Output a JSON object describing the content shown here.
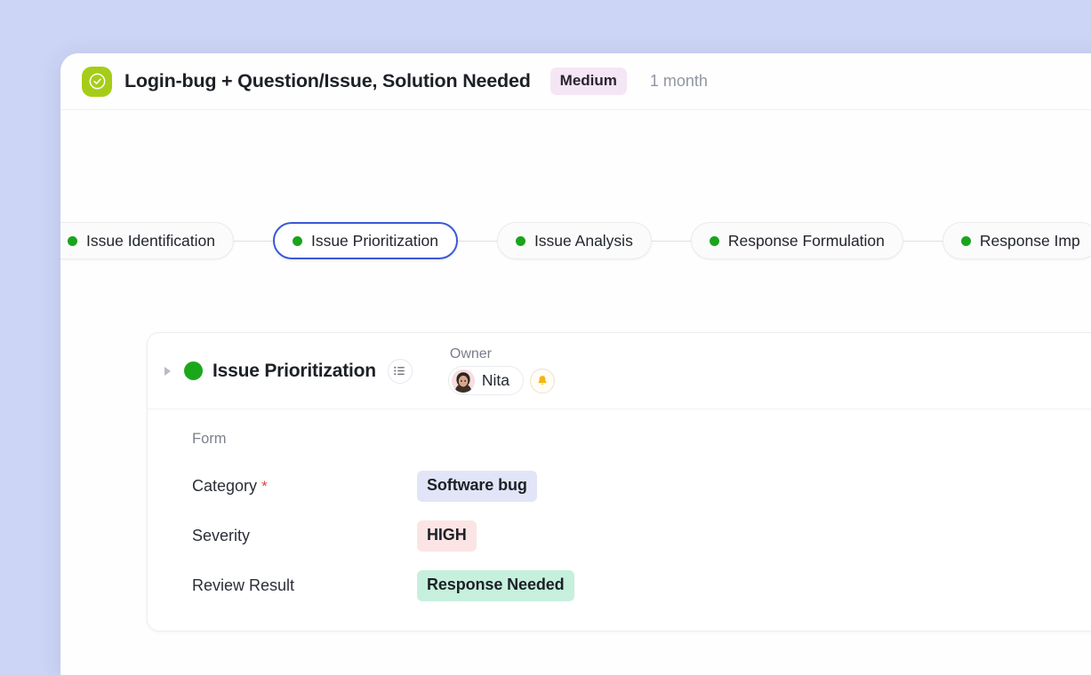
{
  "header": {
    "icon": "check-circle-icon",
    "icon_color": "#a5cd18",
    "title": "Login-bug + Question/Issue, Solution Needed",
    "priority_badge": "Medium",
    "priority_badge_color": "#f5e6f5",
    "duration": "1 month"
  },
  "stepper": {
    "steps": [
      {
        "label": "Issue Identification",
        "dot_color": "#1ba41b",
        "active": false,
        "clipped": true
      },
      {
        "label": "Issue Prioritization",
        "dot_color": "#1ba41b",
        "active": true,
        "clipped": false
      },
      {
        "label": "Issue Analysis",
        "dot_color": "#1ba41b",
        "active": false,
        "clipped": false
      },
      {
        "label": "Response Formulation",
        "dot_color": "#1ba41b",
        "active": false,
        "clipped": false
      },
      {
        "label": "Response Imp",
        "dot_color": "#1ba41b",
        "active": false,
        "clipped": false
      }
    ],
    "active_border_color": "#3b58d8"
  },
  "stage": {
    "caret": "caret-right-icon",
    "dot_color": "#1aa81a",
    "title": "Issue Prioritization",
    "list_icon": "list-icon",
    "owner": {
      "label": "Owner",
      "name": "Nita",
      "avatar": "user-avatar",
      "bell_icon": "bell-icon"
    },
    "status_icon": "check-circle-filled-icon",
    "status_color": "#1aa81a"
  },
  "form": {
    "section_label": "Form",
    "fields": [
      {
        "name": "Category",
        "required": true,
        "value": "Software bug",
        "chip_color": "#e2e5f7"
      },
      {
        "name": "Severity",
        "required": false,
        "value": "HIGH",
        "chip_color": "#fbe4e4"
      },
      {
        "name": "Review Result",
        "required": false,
        "value": "Response Needed",
        "chip_color": "#c6f0dd"
      }
    ]
  },
  "theme": {
    "page_background": "#ccd5f6",
    "card_background": "#fdfefd"
  }
}
